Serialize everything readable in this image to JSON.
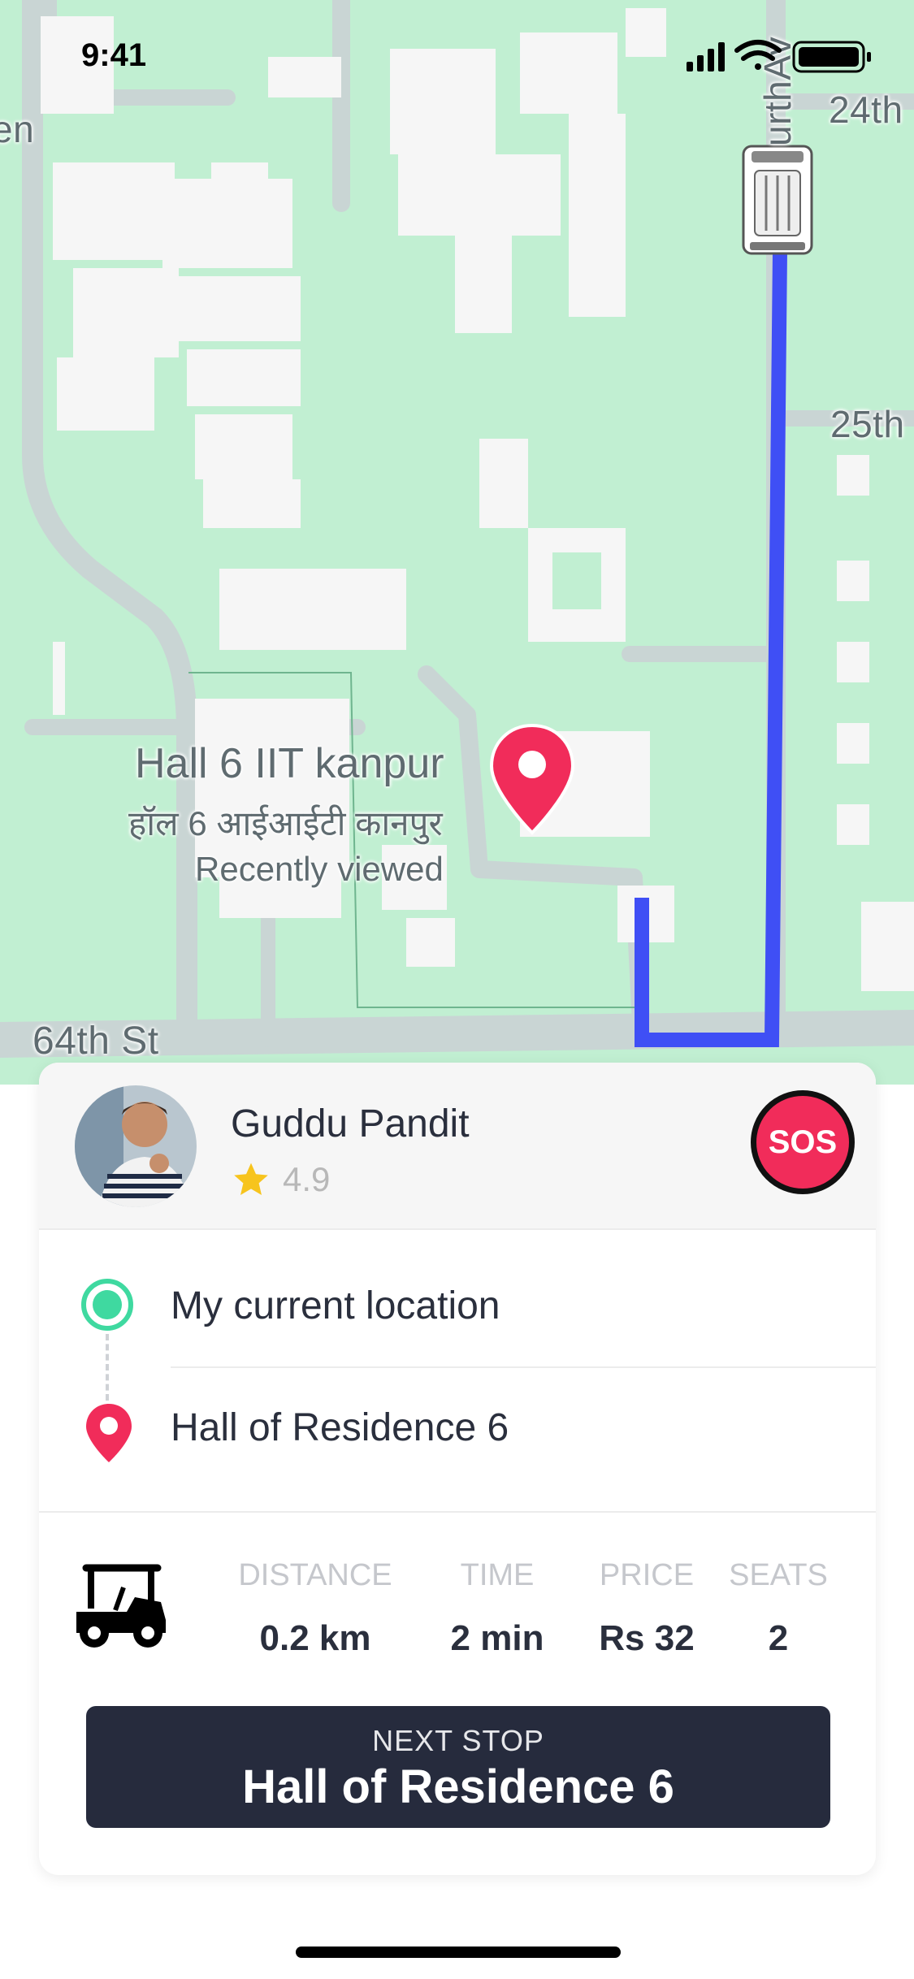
{
  "status_bar": {
    "time": "9:41"
  },
  "map": {
    "streets": [
      "24th",
      "25th",
      "64th St",
      "urthAv",
      "en"
    ],
    "place": {
      "title": "Hall 6 IIT kanpur",
      "subtitle_hindi": "हॉल 6 आईआईटी कानपुर",
      "note": "Recently viewed"
    },
    "colors": {
      "background": "#c1efd2",
      "route": "#3f4ff5",
      "pin": "#f12c5a",
      "block": "#f6f6f6",
      "road": "#c8d4d2"
    }
  },
  "driver": {
    "name": "Guddu Pandit",
    "rating": "4.9",
    "sos_label": "SOS"
  },
  "route": {
    "origin": "My current location",
    "destination": "Hall of Residence 6"
  },
  "trip": {
    "vehicle_icon": "golf-cart-icon",
    "stats": [
      {
        "label": "DISTANCE",
        "value": "0.2 km"
      },
      {
        "label": "TIME",
        "value": "2 min"
      },
      {
        "label": "PRICE",
        "value": "Rs 32"
      },
      {
        "label": "SEATS",
        "value": "2"
      }
    ]
  },
  "next_stop": {
    "label": "NEXT STOP",
    "value": "Hall of Residence 6"
  }
}
